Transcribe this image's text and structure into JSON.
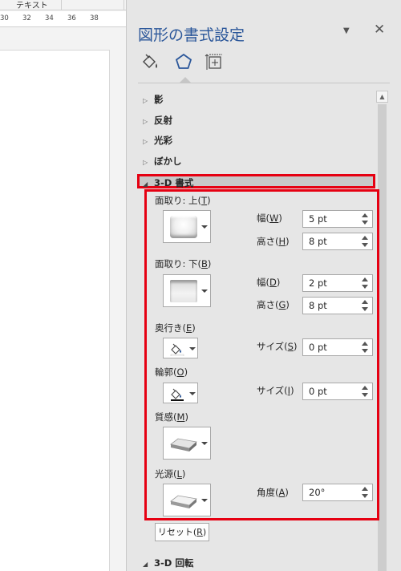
{
  "document": {
    "tab_label": "テキスト",
    "ruler_ticks": [
      "30",
      "32",
      "34",
      "36",
      "38"
    ]
  },
  "pane": {
    "title": "図形の書式設定",
    "tabs": [
      {
        "name": "塗りつぶしと線",
        "icon": "paint-bucket-icon",
        "selected": false
      },
      {
        "name": "効果",
        "icon": "pentagon-icon",
        "selected": true
      },
      {
        "name": "サイズとプロパティ",
        "icon": "size-properties-icon",
        "selected": false
      }
    ],
    "sections": {
      "shadow": "影",
      "reflection": "反射",
      "glow": "光彩",
      "soft_edges": "ぼかし",
      "format3d": "3-D 書式",
      "rotation3d": "3-D 回転"
    },
    "format3d": {
      "bevel_top": {
        "label": "面取り: 上",
        "key": "T",
        "icon": "bevel-circle-icon"
      },
      "bevel_bottom": {
        "label": "面取り: 下",
        "key": "B",
        "icon": "bevel-square-icon"
      },
      "top_width": {
        "label": "幅",
        "key": "W",
        "value": "5 pt"
      },
      "top_height": {
        "label": "高さ",
        "key": "H",
        "value": "8 pt"
      },
      "bottom_width": {
        "label": "幅",
        "key": "D",
        "value": "2 pt"
      },
      "bottom_height": {
        "label": "高さ",
        "key": "G",
        "value": "8 pt"
      },
      "depth": {
        "label": "奥行き",
        "key": "E",
        "icon": "paint-fill-icon"
      },
      "depth_size": {
        "label": "サイズ",
        "key": "S",
        "value": "0 pt"
      },
      "contour": {
        "label": "輪郭",
        "key": "O",
        "icon": "paint-fill-icon"
      },
      "contour_size": {
        "label": "サイズ",
        "key": "I",
        "value": "0 pt"
      },
      "material": {
        "label": "質感",
        "key": "M",
        "icon": "material-icon"
      },
      "lighting": {
        "label": "光源",
        "key": "L",
        "icon": "lighting-icon"
      },
      "angle": {
        "label": "角度",
        "key": "A",
        "value": "20°"
      },
      "reset": {
        "label": "リセット",
        "key": "R"
      }
    },
    "colors": {
      "title": "#2b579a",
      "highlight": "#e60012"
    }
  }
}
